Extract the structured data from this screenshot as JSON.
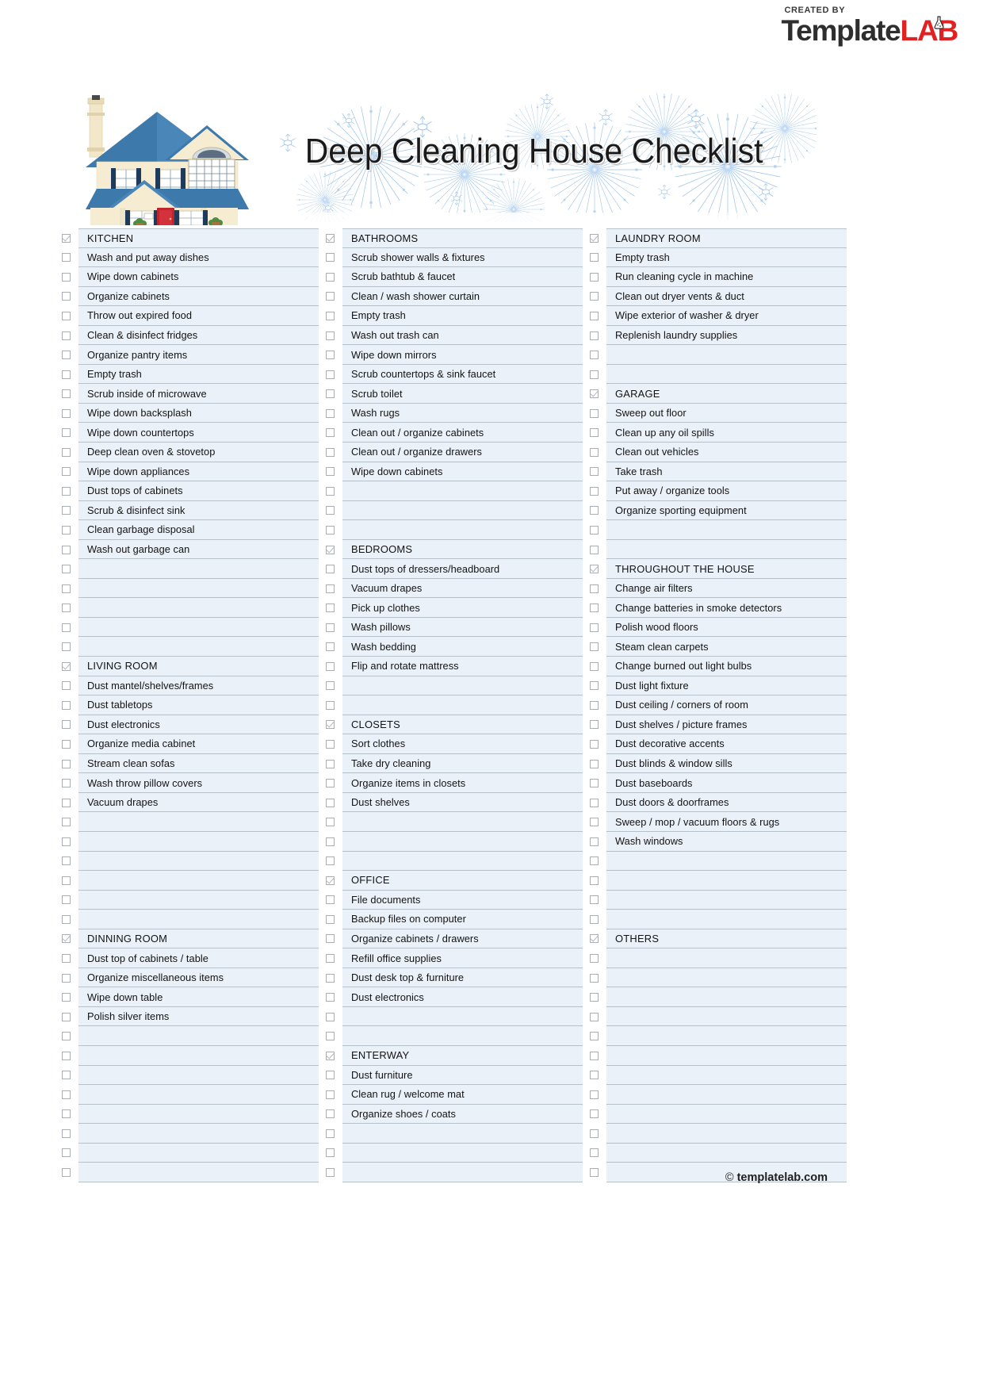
{
  "brand": {
    "created_by": "CREATED BY",
    "name_dark": "Template",
    "name_red": "LAB"
  },
  "header": {
    "title": "Deep Cleaning House Checklist",
    "house_illustration": "house-illustration",
    "banner_background": "blue-firework-snowflake-pattern"
  },
  "footer": {
    "copyright_symbol": "©",
    "domain": "templatelab.com"
  },
  "colors": {
    "row_background": "#eaf1f8",
    "row_border": "#b6c0c9",
    "checkbox_border": "#a9aeb4",
    "brand_red": "#e02222",
    "brand_dark": "#2e2e2e",
    "text": "#131313"
  },
  "columns": [
    {
      "name": "column-1",
      "rows": [
        {
          "text": "KITCHEN",
          "type": "header",
          "checked": true
        },
        {
          "text": "Wash and put away dishes",
          "type": "item",
          "checked": false
        },
        {
          "text": "Wipe down cabinets",
          "type": "item",
          "checked": false
        },
        {
          "text": "Organize cabinets",
          "type": "item",
          "checked": false
        },
        {
          "text": "Throw out expired food",
          "type": "item",
          "checked": false
        },
        {
          "text": "Clean & disinfect fridges",
          "type": "item",
          "checked": false
        },
        {
          "text": "Organize pantry items",
          "type": "item",
          "checked": false
        },
        {
          "text": "Empty trash",
          "type": "item",
          "checked": false
        },
        {
          "text": "Scrub inside of microwave",
          "type": "item",
          "checked": false
        },
        {
          "text": "Wipe down backsplash",
          "type": "item",
          "checked": false
        },
        {
          "text": "Wipe down countertops",
          "type": "item",
          "checked": false
        },
        {
          "text": "Deep clean oven & stovetop",
          "type": "item",
          "checked": false
        },
        {
          "text": "Wipe down appliances",
          "type": "item",
          "checked": false
        },
        {
          "text": "Dust tops of cabinets",
          "type": "item",
          "checked": false
        },
        {
          "text": "Scrub & disinfect sink",
          "type": "item",
          "checked": false
        },
        {
          "text": "Clean garbage disposal",
          "type": "item",
          "checked": false
        },
        {
          "text": "Wash out garbage can",
          "type": "item",
          "checked": false
        },
        {
          "text": "",
          "type": "blank",
          "checked": false
        },
        {
          "text": "",
          "type": "blank",
          "checked": false
        },
        {
          "text": "",
          "type": "blank",
          "checked": false
        },
        {
          "text": "",
          "type": "blank",
          "checked": false
        },
        {
          "text": "",
          "type": "blank",
          "checked": false
        },
        {
          "text": "LIVING ROOM",
          "type": "header",
          "checked": true
        },
        {
          "text": "Dust mantel/shelves/frames",
          "type": "item",
          "checked": false
        },
        {
          "text": "Dust tabletops",
          "type": "item",
          "checked": false
        },
        {
          "text": "Dust electronics",
          "type": "item",
          "checked": false
        },
        {
          "text": "Organize media cabinet",
          "type": "item",
          "checked": false
        },
        {
          "text": "Stream clean sofas",
          "type": "item",
          "checked": false
        },
        {
          "text": "Wash throw pillow covers",
          "type": "item",
          "checked": false
        },
        {
          "text": "Vacuum drapes",
          "type": "item",
          "checked": false
        },
        {
          "text": "",
          "type": "blank",
          "checked": false
        },
        {
          "text": "",
          "type": "blank",
          "checked": false
        },
        {
          "text": "",
          "type": "blank",
          "checked": false
        },
        {
          "text": "",
          "type": "blank",
          "checked": false
        },
        {
          "text": "",
          "type": "blank",
          "checked": false
        },
        {
          "text": "",
          "type": "blank",
          "checked": false
        },
        {
          "text": "DINNING ROOM",
          "type": "header",
          "checked": true
        },
        {
          "text": "Dust top of cabinets / table",
          "type": "item",
          "checked": false
        },
        {
          "text": "Organize miscellaneous items",
          "type": "item",
          "checked": false
        },
        {
          "text": "Wipe down table",
          "type": "item",
          "checked": false
        },
        {
          "text": "Polish silver items",
          "type": "item",
          "checked": false
        },
        {
          "text": "",
          "type": "blank",
          "checked": false
        },
        {
          "text": "",
          "type": "blank",
          "checked": false
        },
        {
          "text": "",
          "type": "blank",
          "checked": false
        },
        {
          "text": "",
          "type": "blank",
          "checked": false
        },
        {
          "text": "",
          "type": "blank",
          "checked": false
        },
        {
          "text": "",
          "type": "blank",
          "checked": false
        },
        {
          "text": "",
          "type": "blank",
          "checked": false
        },
        {
          "text": "",
          "type": "blank",
          "checked": false
        }
      ]
    },
    {
      "name": "column-2",
      "rows": [
        {
          "text": "BATHROOMS",
          "type": "header",
          "checked": true
        },
        {
          "text": "Scrub shower walls & fixtures",
          "type": "item",
          "checked": false
        },
        {
          "text": "Scrub bathtub & faucet",
          "type": "item",
          "checked": false
        },
        {
          "text": "Clean / wash shower curtain",
          "type": "item",
          "checked": false
        },
        {
          "text": "Empty trash",
          "type": "item",
          "checked": false
        },
        {
          "text": "Wash out trash can",
          "type": "item",
          "checked": false
        },
        {
          "text": "Wipe down mirrors",
          "type": "item",
          "checked": false
        },
        {
          "text": "Scrub countertops & sink faucet",
          "type": "item",
          "checked": false
        },
        {
          "text": "Scrub toilet",
          "type": "item",
          "checked": false
        },
        {
          "text": "Wash rugs",
          "type": "item",
          "checked": false
        },
        {
          "text": "Clean out / organize cabinets",
          "type": "item",
          "checked": false
        },
        {
          "text": "Clean out / organize drawers",
          "type": "item",
          "checked": false
        },
        {
          "text": "Wipe down cabinets",
          "type": "item",
          "checked": false
        },
        {
          "text": "",
          "type": "blank",
          "checked": false
        },
        {
          "text": "",
          "type": "blank",
          "checked": false
        },
        {
          "text": "",
          "type": "blank",
          "checked": false
        },
        {
          "text": "BEDROOMS",
          "type": "header",
          "checked": true
        },
        {
          "text": "Dust tops of dressers/headboard",
          "type": "item",
          "checked": false
        },
        {
          "text": "Vacuum drapes",
          "type": "item",
          "checked": false
        },
        {
          "text": "Pick up clothes",
          "type": "item",
          "checked": false
        },
        {
          "text": "Wash pillows",
          "type": "item",
          "checked": false
        },
        {
          "text": "Wash bedding",
          "type": "item",
          "checked": false
        },
        {
          "text": "Flip and rotate mattress",
          "type": "item",
          "checked": false
        },
        {
          "text": "",
          "type": "blank",
          "checked": false
        },
        {
          "text": "",
          "type": "blank",
          "checked": false
        },
        {
          "text": "CLOSETS",
          "type": "header",
          "checked": true
        },
        {
          "text": "Sort clothes",
          "type": "item",
          "checked": false
        },
        {
          "text": "Take dry cleaning",
          "type": "item",
          "checked": false
        },
        {
          "text": "Organize items in closets",
          "type": "item",
          "checked": false
        },
        {
          "text": "Dust shelves",
          "type": "item",
          "checked": false
        },
        {
          "text": "",
          "type": "blank",
          "checked": false
        },
        {
          "text": "",
          "type": "blank",
          "checked": false
        },
        {
          "text": "",
          "type": "blank",
          "checked": false
        },
        {
          "text": "OFFICE",
          "type": "header",
          "checked": true
        },
        {
          "text": "File documents",
          "type": "item",
          "checked": false
        },
        {
          "text": "Backup files on computer",
          "type": "item",
          "checked": false
        },
        {
          "text": "Organize cabinets / drawers",
          "type": "item",
          "checked": false
        },
        {
          "text": "Refill office supplies",
          "type": "item",
          "checked": false
        },
        {
          "text": "Dust desk top & furniture",
          "type": "item",
          "checked": false
        },
        {
          "text": "Dust electronics",
          "type": "item",
          "checked": false
        },
        {
          "text": "",
          "type": "blank",
          "checked": false
        },
        {
          "text": "",
          "type": "blank",
          "checked": false
        },
        {
          "text": "ENTERWAY",
          "type": "header",
          "checked": true
        },
        {
          "text": "Dust furniture",
          "type": "item",
          "checked": false
        },
        {
          "text": "Clean rug / welcome mat",
          "type": "item",
          "checked": false
        },
        {
          "text": "Organize shoes / coats",
          "type": "item",
          "checked": false
        },
        {
          "text": "",
          "type": "blank",
          "checked": false
        },
        {
          "text": "",
          "type": "blank",
          "checked": false
        },
        {
          "text": "",
          "type": "blank",
          "checked": false
        }
      ]
    },
    {
      "name": "column-3",
      "rows": [
        {
          "text": "LAUNDRY ROOM",
          "type": "header",
          "checked": true
        },
        {
          "text": "Empty trash",
          "type": "item",
          "checked": false
        },
        {
          "text": "Run cleaning cycle in machine",
          "type": "item",
          "checked": false
        },
        {
          "text": "Clean out dryer vents & duct",
          "type": "item",
          "checked": false
        },
        {
          "text": "Wipe exterior of washer & dryer",
          "type": "item",
          "checked": false
        },
        {
          "text": "Replenish laundry supplies",
          "type": "item",
          "checked": false
        },
        {
          "text": "",
          "type": "blank",
          "checked": false
        },
        {
          "text": "",
          "type": "blank",
          "checked": false
        },
        {
          "text": "GARAGE",
          "type": "header",
          "checked": true
        },
        {
          "text": "Sweep out floor",
          "type": "item",
          "checked": false
        },
        {
          "text": "Clean up any oil spills",
          "type": "item",
          "checked": false
        },
        {
          "text": "Clean out vehicles",
          "type": "item",
          "checked": false
        },
        {
          "text": "Take trash",
          "type": "item",
          "checked": false
        },
        {
          "text": "Put away / organize tools",
          "type": "item",
          "checked": false
        },
        {
          "text": "Organize sporting equipment",
          "type": "item",
          "checked": false
        },
        {
          "text": "",
          "type": "blank",
          "checked": false
        },
        {
          "text": "",
          "type": "blank",
          "checked": false
        },
        {
          "text": "THROUGHOUT THE HOUSE",
          "type": "header",
          "checked": true
        },
        {
          "text": "Change air filters",
          "type": "item",
          "checked": false
        },
        {
          "text": "Change batteries in smoke detectors",
          "type": "item",
          "checked": false
        },
        {
          "text": "Polish wood floors",
          "type": "item",
          "checked": false
        },
        {
          "text": "Steam clean carpets",
          "type": "item",
          "checked": false
        },
        {
          "text": "Change burned out light bulbs",
          "type": "item",
          "checked": false
        },
        {
          "text": "Dust light fixture",
          "type": "item",
          "checked": false
        },
        {
          "text": "Dust ceiling / corners of room",
          "type": "item",
          "checked": false
        },
        {
          "text": "Dust shelves / picture frames",
          "type": "item",
          "checked": false
        },
        {
          "text": "Dust decorative accents",
          "type": "item",
          "checked": false
        },
        {
          "text": "Dust blinds & window sills",
          "type": "item",
          "checked": false
        },
        {
          "text": "Dust baseboards",
          "type": "item",
          "checked": false
        },
        {
          "text": "Dust doors & doorframes",
          "type": "item",
          "checked": false
        },
        {
          "text": "Sweep / mop / vacuum floors & rugs",
          "type": "item",
          "checked": false
        },
        {
          "text": "Wash windows",
          "type": "item",
          "checked": false
        },
        {
          "text": "",
          "type": "blank",
          "checked": false
        },
        {
          "text": "",
          "type": "blank",
          "checked": false
        },
        {
          "text": "",
          "type": "blank",
          "checked": false
        },
        {
          "text": "",
          "type": "blank",
          "checked": false
        },
        {
          "text": "OTHERS",
          "type": "header",
          "checked": true
        },
        {
          "text": "",
          "type": "blank",
          "checked": false
        },
        {
          "text": "",
          "type": "blank",
          "checked": false
        },
        {
          "text": "",
          "type": "blank",
          "checked": false
        },
        {
          "text": "",
          "type": "blank",
          "checked": false
        },
        {
          "text": "",
          "type": "blank",
          "checked": false
        },
        {
          "text": "",
          "type": "blank",
          "checked": false
        },
        {
          "text": "",
          "type": "blank",
          "checked": false
        },
        {
          "text": "",
          "type": "blank",
          "checked": false
        },
        {
          "text": "",
          "type": "blank",
          "checked": false
        },
        {
          "text": "",
          "type": "blank",
          "checked": false
        },
        {
          "text": "",
          "type": "blank",
          "checked": false
        },
        {
          "text": "",
          "type": "blank",
          "checked": false
        }
      ]
    }
  ]
}
